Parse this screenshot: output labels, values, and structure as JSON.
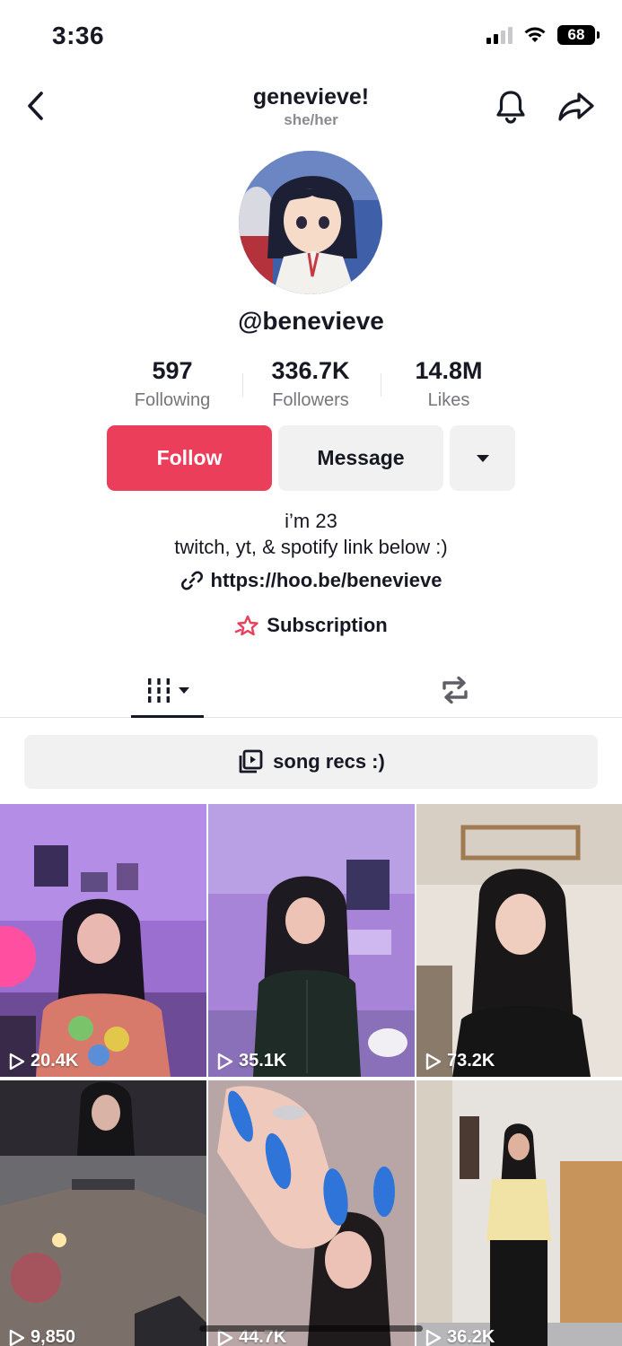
{
  "status": {
    "time": "3:36",
    "battery": "68"
  },
  "nav": {
    "title": "genevieve!",
    "pronouns": "she/her"
  },
  "profile": {
    "handle": "@benevieve",
    "stats": [
      {
        "value": "597",
        "label": "Following"
      },
      {
        "value": "336.7K",
        "label": "Followers"
      },
      {
        "value": "14.8M",
        "label": "Likes"
      }
    ],
    "bio_line1": "i’m 23",
    "bio_line2": "twitch, yt, & spotify link below :)",
    "link": "https://hoo.be/benevieve",
    "subscription": "Subscription"
  },
  "actions": {
    "follow": "Follow",
    "message": "Message"
  },
  "playlist": {
    "label": "song recs :)"
  },
  "videos": [
    {
      "views": "20.4K"
    },
    {
      "views": "35.1K"
    },
    {
      "views": "73.2K"
    },
    {
      "views": "9,850"
    },
    {
      "views": "44.7K"
    },
    {
      "views": "36.2K"
    }
  ],
  "colors": {
    "accent": "#ea3e5b",
    "text": "#161823",
    "muted": "#75767c",
    "button_bg": "#f1f1f2"
  }
}
